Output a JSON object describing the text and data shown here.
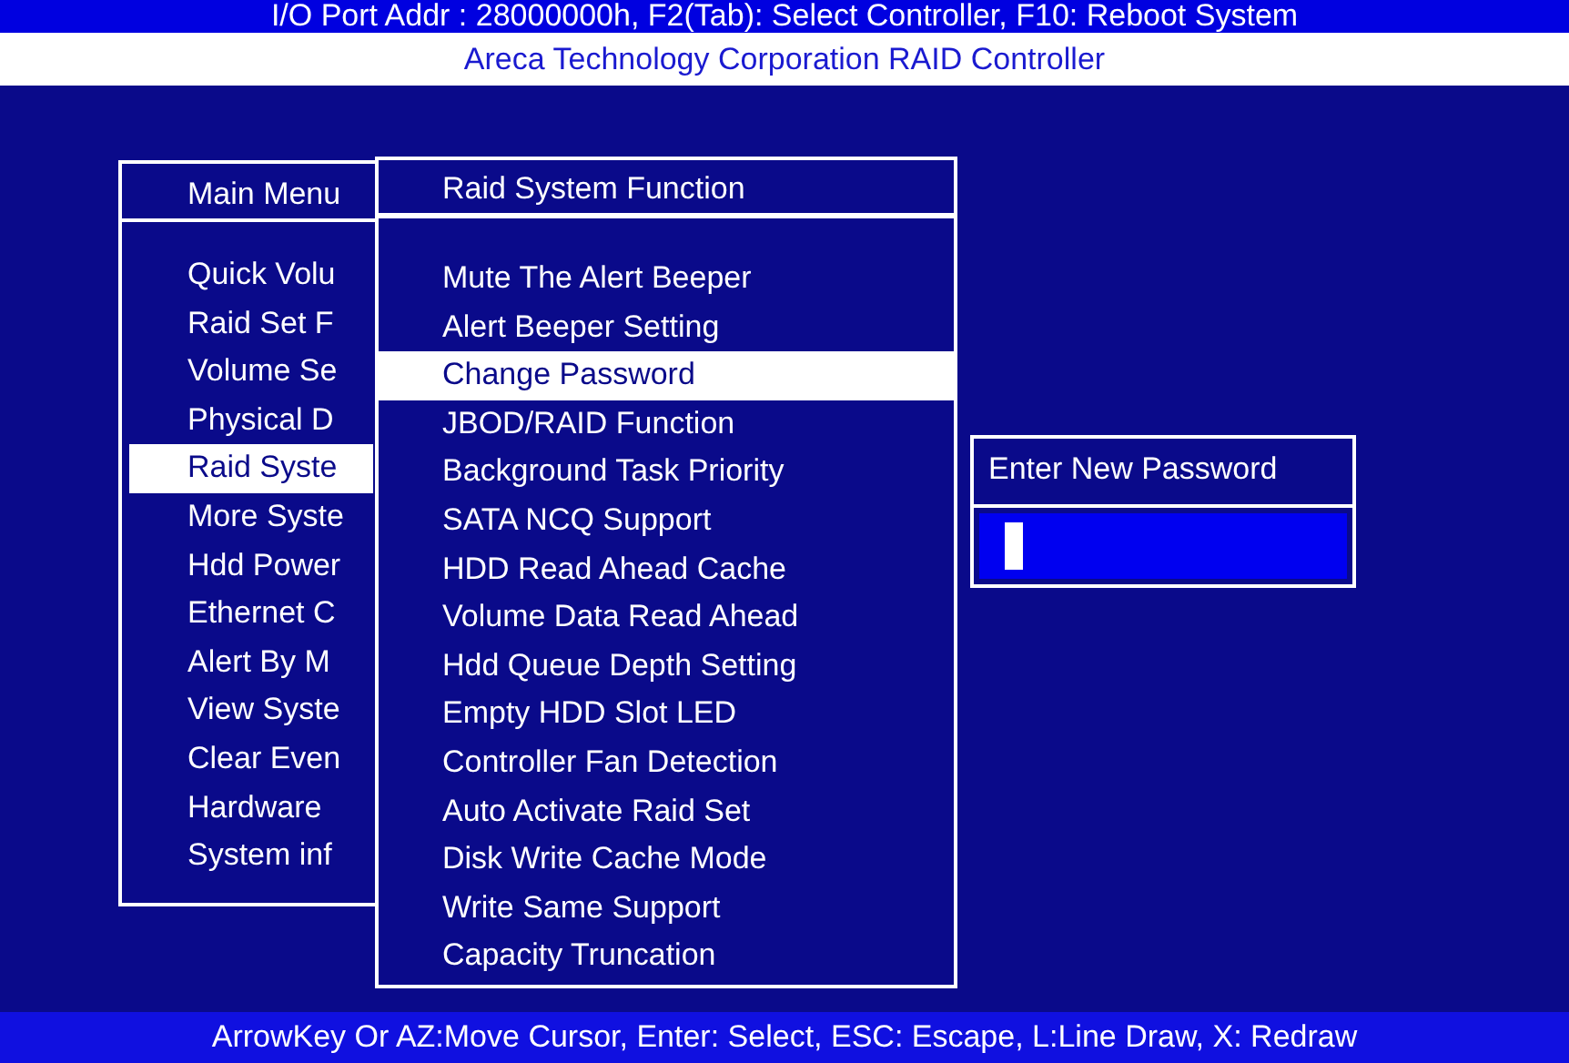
{
  "header": {
    "hint": "I/O Port Addr : 28000000h, F2(Tab): Select Controller, F10: Reboot System",
    "title": "Areca Technology Corporation RAID Controller"
  },
  "main_menu": {
    "title": "Main Menu",
    "items": [
      {
        "label": "Quick Volu",
        "selected": false
      },
      {
        "label": "Raid Set F",
        "selected": false
      },
      {
        "label": "Volume Se",
        "selected": false
      },
      {
        "label": "Physical D",
        "selected": false
      },
      {
        "label": "Raid Syste",
        "selected": true
      },
      {
        "label": "More Syste",
        "selected": false
      },
      {
        "label": "Hdd Power",
        "selected": false
      },
      {
        "label": "Ethernet C",
        "selected": false
      },
      {
        "label": "Alert By M",
        "selected": false
      },
      {
        "label": "View Syste",
        "selected": false
      },
      {
        "label": "Clear Even",
        "selected": false
      },
      {
        "label": "Hardware",
        "selected": false
      },
      {
        "label": "System inf",
        "selected": false
      }
    ]
  },
  "submenu": {
    "title": "Raid System Function",
    "items": [
      {
        "label": "Mute The Alert Beeper",
        "selected": false
      },
      {
        "label": "Alert Beeper Setting",
        "selected": false
      },
      {
        "label": "Change Password",
        "selected": true
      },
      {
        "label": "JBOD/RAID Function",
        "selected": false
      },
      {
        "label": "Background Task Priority",
        "selected": false
      },
      {
        "label": "SATA NCQ Support",
        "selected": false
      },
      {
        "label": "HDD Read Ahead Cache",
        "selected": false
      },
      {
        "label": "Volume Data Read Ahead",
        "selected": false
      },
      {
        "label": "Hdd Queue Depth Setting",
        "selected": false
      },
      {
        "label": "Empty HDD Slot LED",
        "selected": false
      },
      {
        "label": "Controller Fan Detection",
        "selected": false
      },
      {
        "label": "Auto Activate Raid Set",
        "selected": false
      },
      {
        "label": "Disk Write Cache Mode",
        "selected": false
      },
      {
        "label": "Write Same Support",
        "selected": false
      },
      {
        "label": "Capacity Truncation",
        "selected": false
      }
    ]
  },
  "password_dialog": {
    "title": "Enter New Password"
  },
  "status_bar": "ArrowKey Or AZ:Move Cursor, Enter: Select, ESC: Escape, L:Line Draw, X: Redraw"
}
